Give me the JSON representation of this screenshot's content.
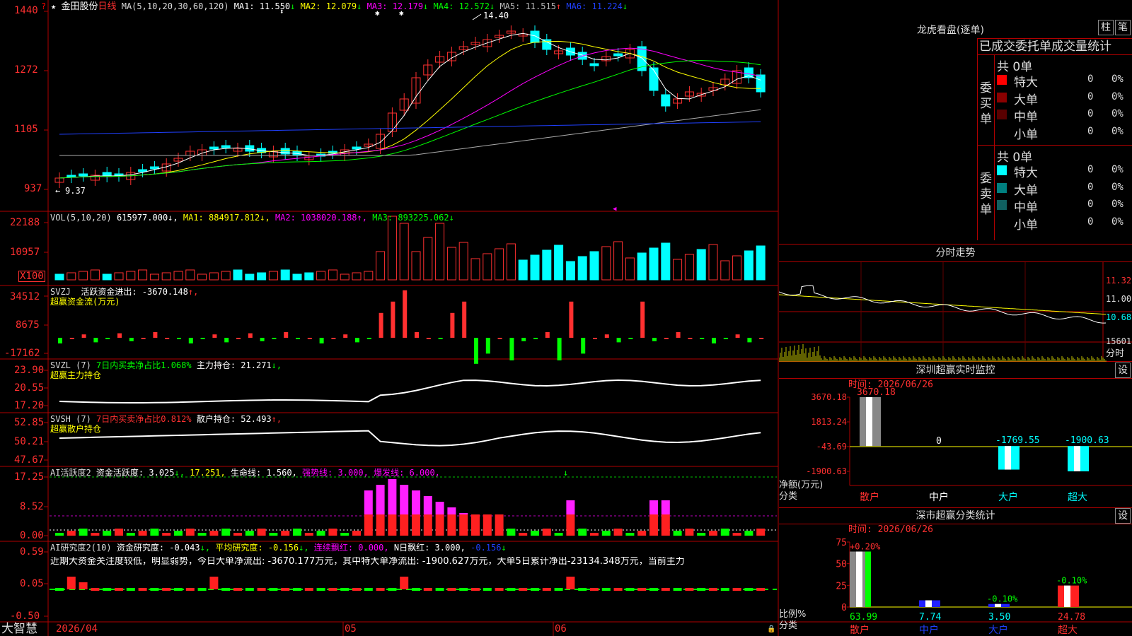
{
  "app": {
    "name": "大智慧"
  },
  "stock": {
    "name": "金田股份",
    "period": "日线",
    "star": "★",
    "question": "?"
  },
  "main_header": {
    "ma_label": "MA(5,10,20,30,60,120)",
    "items": [
      {
        "label": "MA1:",
        "value": "11.550",
        "arrow": "↓",
        "color": "#ffffff"
      },
      {
        "label": "MA2:",
        "value": "12.079",
        "arrow": "↓",
        "color": "#ffff00"
      },
      {
        "label": "MA3:",
        "value": "12.179",
        "arrow": "↓",
        "color": "#ff00ff"
      },
      {
        "label": "MA4:",
        "value": "12.572",
        "arrow": "↓",
        "color": "#00ff00"
      },
      {
        "label": "MA5:",
        "value": "11.515",
        "arrow": "↑",
        "color": "#bbbbbb"
      },
      {
        "label": "MA6:",
        "value": "11.224",
        "arrow": "↓",
        "color": "#2040ff"
      }
    ],
    "high_label": "14.40",
    "low_label": "9.37"
  },
  "axes": {
    "price": [
      "1440",
      "1272",
      "1105",
      "937"
    ],
    "vol": [
      "22188",
      "10957",
      "X100"
    ],
    "svzj": [
      "34512",
      "8675",
      "-17162"
    ],
    "svzl": [
      "23.90",
      "20.55",
      "17.20"
    ],
    "svsh": [
      "52.85",
      "50.21",
      "47.67"
    ],
    "ai": [
      "17.25",
      "8.52",
      "0.00"
    ],
    "air": [
      "0.59",
      "0.05",
      "-0.50"
    ]
  },
  "vol_header": {
    "label": "VOL(5,10,20)",
    "value": "615977.000↓,",
    "ma1": "MA1: 884917.812↓,",
    "ma2": "MA2: 1038020.188↑,",
    "ma3": "MA3: 893225.062↓"
  },
  "svzj_header": {
    "label": "SVZJ",
    "text": "活跃资金进出: -3670.148",
    "arrow": "↑,",
    "line2": "超赢资金流(万元)"
  },
  "svzl_header": {
    "label": "SVZL (7)",
    "text": "7日内买卖净占比1.068%",
    "text2": "主力持仓: 21.271",
    "arrow": "↓,",
    "line2": "超赢主力持仓"
  },
  "svsh_header": {
    "label": "SVSH (7)",
    "text": "7日内买卖净占比0.812%",
    "text2": "散户持仓: 52.493",
    "arrow": "↑,",
    "line2": "超赢散户持仓"
  },
  "ai_header": {
    "label": "AI活跃度2",
    "t1": "资金活跃度: 3.025",
    "a1": "↓,",
    "t2": "17.251,",
    "t3": "生命线: 1.560,",
    "t4": "强势线: 3.000,",
    "t5": "爆发线: 6.000,"
  },
  "air_header": {
    "label": "AI研究度2(10)",
    "t1": "资金研究度: -0.043",
    "a1": "↓,",
    "t2": "平均研究度: -0.156",
    "a2": "↓,",
    "t3": "连续飘红: 0.000,",
    "t4": "N日飘红: 3.000,",
    "t5": "-0.156",
    "a5": "↓",
    "comment": "近期大资金关注度较低，明显弱势，今日大单净流出: -3670.177万元，其中特大单净流出: -1900.627万元，大单5日累计净出-23134.348万元，当前主力"
  },
  "dates": {
    "d1": "2026/04",
    "d2": "05",
    "d3": "06"
  },
  "longhu": {
    "title": "龙虎看盘(逐单)",
    "btn1": "柱",
    "btn2": "笔",
    "subtitle": "已成交委托单成交量统计",
    "buy": {
      "side": [
        "委",
        "买",
        "单"
      ],
      "total": "共 0单",
      "rows": [
        {
          "name": "特大",
          "count": "0",
          "pct": "0%",
          "color": "#ff0000"
        },
        {
          "name": "大单",
          "count": "0",
          "pct": "0%",
          "color": "#8b0000"
        },
        {
          "name": "中单",
          "count": "0",
          "pct": "0%",
          "color": "#5a0000"
        },
        {
          "name": "小单",
          "count": "0",
          "pct": "0%",
          "color": ""
        }
      ]
    },
    "sell": {
      "side": [
        "委",
        "卖",
        "单"
      ],
      "total": "共 0单",
      "rows": [
        {
          "name": "特大",
          "count": "0",
          "pct": "0%",
          "color": "#00ffff"
        },
        {
          "name": "大单",
          "count": "0",
          "pct": "0%",
          "color": "#008080"
        },
        {
          "name": "中单",
          "count": "0",
          "pct": "0%",
          "color": "#106060"
        },
        {
          "name": "小单",
          "count": "0",
          "pct": "0%",
          "color": ""
        }
      ]
    }
  },
  "intraday": {
    "title": "分时走势",
    "prices": [
      "11.32",
      "11.00",
      "10.68"
    ],
    "volume": "15601",
    "footer": "分时"
  },
  "sz_monitor": {
    "title": "深圳超赢实时监控",
    "btn": "设",
    "time": "时间: 2026/06/26",
    "axis": [
      "3670.18",
      "1813.24",
      "-43.69",
      "-1900.63"
    ],
    "ylabel": "净额(万元)",
    "xlabel": "分类",
    "categories": [
      "散户",
      "中户",
      "大户",
      "超大"
    ],
    "values": [
      3670.18,
      0,
      -1769.55,
      -1900.63
    ],
    "value_labels": [
      "3670.18",
      "0",
      "-1769.55",
      "-1900.63"
    ]
  },
  "sz_classify": {
    "title": "深市超赢分类统计",
    "btn": "设",
    "time": "时间: 2026/06/26",
    "axis": [
      "75",
      "50",
      "25",
      "0"
    ],
    "ylabel": "比例%",
    "xlabel": "分类",
    "categories": [
      "散户",
      "中户",
      "大户",
      "超大"
    ],
    "values": [
      63.99,
      7.74,
      3.5,
      24.78
    ],
    "value_labels": [
      "63.99",
      "7.74",
      "3.50",
      "24.78"
    ],
    "changes": [
      "+0.20%",
      "",
      "-0.10%",
      "-0.10%"
    ]
  }
}
